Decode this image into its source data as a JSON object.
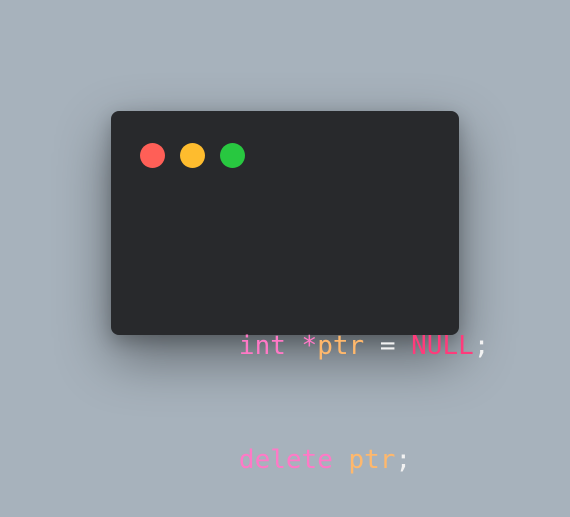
{
  "colors": {
    "background": "#a7b2bc",
    "window": "#28292c",
    "dot_red": "#ff5f57",
    "dot_yellow": "#febc2e",
    "dot_green": "#28c840",
    "keyword": "#ff79c6",
    "identifier": "#ffb86c",
    "null": "#ff3b7b",
    "punctuation": "#f2f2f2"
  },
  "window": {
    "controls": [
      {
        "name": "close",
        "color": "#ff5f57"
      },
      {
        "name": "minimize",
        "color": "#febc2e"
      },
      {
        "name": "zoom",
        "color": "#28c840"
      }
    ]
  },
  "code": {
    "lines": [
      [
        {
          "text": "int",
          "kind": "keyword"
        },
        {
          "text": " ",
          "kind": "space"
        },
        {
          "text": "*",
          "kind": "operator"
        },
        {
          "text": "ptr",
          "kind": "identifier"
        },
        {
          "text": " ",
          "kind": "space"
        },
        {
          "text": "=",
          "kind": "eq"
        },
        {
          "text": " ",
          "kind": "space"
        },
        {
          "text": "NULL",
          "kind": "null"
        },
        {
          "text": ";",
          "kind": "punct"
        }
      ],
      [
        {
          "text": "delete",
          "kind": "keyword"
        },
        {
          "text": " ",
          "kind": "space"
        },
        {
          "text": "ptr",
          "kind": "identifier"
        },
        {
          "text": ";",
          "kind": "punct"
        }
      ]
    ]
  }
}
